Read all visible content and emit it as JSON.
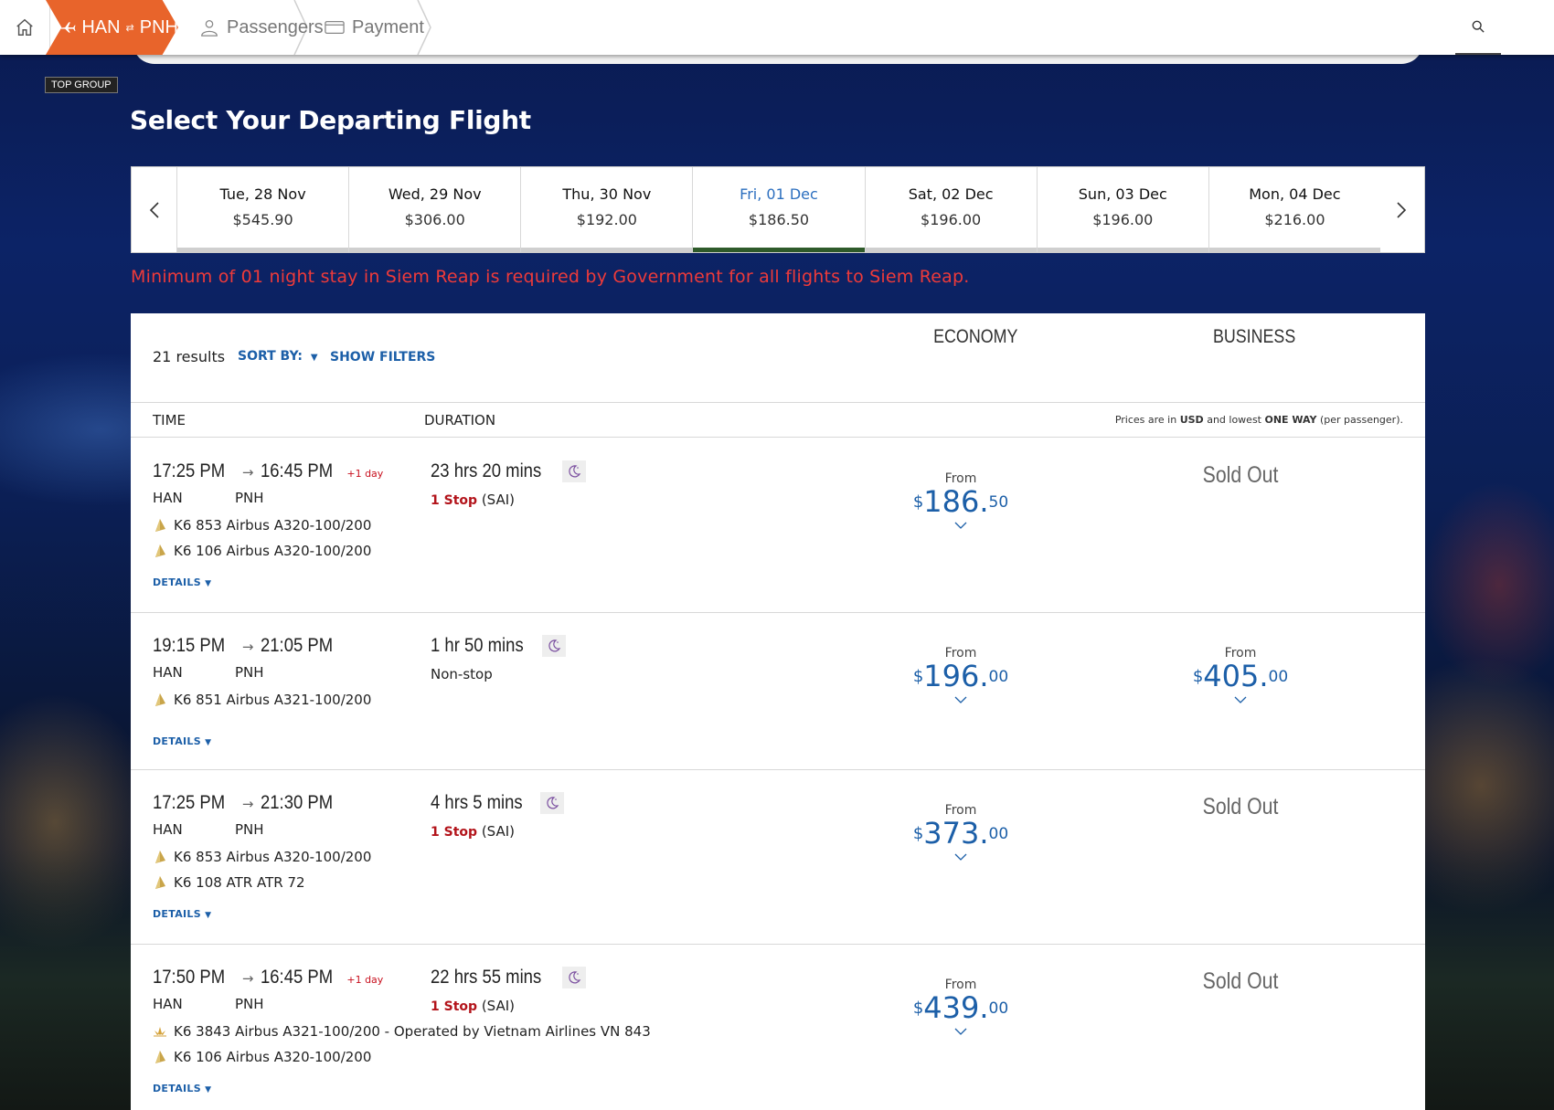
{
  "nav": {
    "route": {
      "from": "HAN",
      "swap": "⇄",
      "to": "PNH"
    },
    "steps": [
      {
        "label": "Passengers"
      },
      {
        "label": "Payment"
      }
    ]
  },
  "badge": "TOP GROUP",
  "page_title": "Select Your Departing Flight",
  "date_strip": {
    "days": [
      {
        "date": "Tue, 28 Nov",
        "price": "$545.90"
      },
      {
        "date": "Wed, 29 Nov",
        "price": "$306.00"
      },
      {
        "date": "Thu, 30 Nov",
        "price": "$192.00"
      },
      {
        "date": "Fri, 01 Dec",
        "price": "$186.50",
        "selected": true
      },
      {
        "date": "Sat, 02 Dec",
        "price": "$196.00"
      },
      {
        "date": "Sun, 03 Dec",
        "price": "$196.00"
      },
      {
        "date": "Mon, 04 Dec",
        "price": "$216.00"
      }
    ]
  },
  "notice": "Minimum of 01 night stay in Siem Reap is required by Government for all flights to Siem Reap.",
  "results": {
    "count": "21 results",
    "sort_by": "SORT BY:",
    "show_filters": "SHOW FILTERS",
    "economy": "ECONOMY",
    "business": "BUSINESS",
    "col_time": "TIME",
    "col_duration": "DURATION",
    "note_pre": "Prices are in ",
    "note_cur": "USD",
    "note_mid": " and lowest ",
    "note_way": "ONE WAY",
    "note_post": " (per passenger).",
    "details": "DETAILS",
    "from_label": "From",
    "sold_out": "Sold Out",
    "currency": "$"
  },
  "flights": [
    {
      "dep": "17:25 PM",
      "arr": "16:45 PM",
      "plus": "+1 day",
      "from": "HAN",
      "to": "PNH",
      "segments": [
        {
          "text": "K6 853  Airbus A320-100/200"
        },
        {
          "text": "K6 106  Airbus A320-100/200"
        }
      ],
      "duration": "23 hrs 20 mins",
      "stops": "1 Stop",
      "via": "(SAI)",
      "economy": {
        "whole": "186.",
        "cents": "50"
      },
      "business": null
    },
    {
      "dep": "19:15 PM",
      "arr": "21:05 PM",
      "plus": "",
      "from": "HAN",
      "to": "PNH",
      "segments": [
        {
          "text": "K6 851  Airbus A321-100/200"
        }
      ],
      "duration": "1 hr 50 mins",
      "stops": "Non-stop",
      "via": "",
      "economy": {
        "whole": "196.",
        "cents": "00"
      },
      "business": {
        "whole": "405.",
        "cents": "00"
      }
    },
    {
      "dep": "17:25 PM",
      "arr": "21:30 PM",
      "plus": "",
      "from": "HAN",
      "to": "PNH",
      "segments": [
        {
          "text": "K6 853  Airbus A320-100/200"
        },
        {
          "text": "K6 108  ATR ATR 72"
        }
      ],
      "duration": "4 hrs 5 mins",
      "stops": "1 Stop",
      "via": "(SAI)",
      "economy": {
        "whole": "373.",
        "cents": "00"
      },
      "business": null
    },
    {
      "dep": "17:50 PM",
      "arr": "16:45 PM",
      "plus": "+1 day",
      "from": "HAN",
      "to": "PNH",
      "segments": [
        {
          "text": "K6 3843  Airbus A321-100/200  -  Operated by Vietnam Airlines VN 843",
          "partner": true
        },
        {
          "text": "K6 106  Airbus A320-100/200"
        }
      ],
      "duration": "22 hrs 55 mins",
      "stops": "1 Stop",
      "via": "(SAI)",
      "economy": {
        "whole": "439.",
        "cents": "00"
      },
      "business": null
    }
  ],
  "colors": {
    "accent": "#e8642b",
    "link": "#1c5fa8",
    "warning": "#ee3a3a",
    "stop_red": "#b3141b"
  }
}
